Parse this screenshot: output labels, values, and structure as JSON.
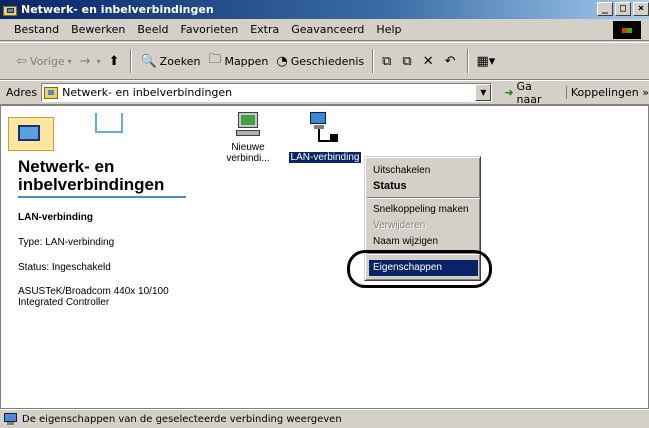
{
  "window": {
    "title": "Netwerk- en inbelverbindingen",
    "buttons": [
      "_",
      "□",
      "×"
    ]
  },
  "menubar": {
    "items": [
      "Bestand",
      "Bewerken",
      "Beeld",
      "Favorieten",
      "Extra",
      "Geavanceerd",
      "Help"
    ]
  },
  "toolbar": {
    "back": "Vorige",
    "forward": "→",
    "up": "⬆",
    "search": "Zoeken",
    "folders": "Mappen",
    "history": "Geschiedenis",
    "views": "▦▾"
  },
  "addressbar": {
    "label": "Adres",
    "value": "Netwerk- en inbelverbindingen",
    "go": "Ga naar",
    "links": "Koppelingen »"
  },
  "webview": {
    "title": "Netwerk- en inbelverbindingen",
    "selected_name": "LAN-verbinding",
    "type_line": "Type: LAN-verbinding",
    "status_line": "Status: Ingeschakeld",
    "device_line1": "ASUSTeK/Broadcom 440x 10/100",
    "device_line2": "Integrated Controller"
  },
  "icons": [
    {
      "label_line1": "Nieuwe",
      "label_line2": "verbindi..."
    },
    {
      "label": "LAN-verbinding"
    }
  ],
  "context_menu": {
    "items": [
      {
        "label": "Uitschakelen",
        "style": "normal"
      },
      {
        "label": "Status",
        "style": "bold"
      },
      {
        "label": "Snelkoppeling maken",
        "style": "normal"
      },
      {
        "label": "Verwijderen",
        "style": "disabled"
      },
      {
        "label": "Naam wijzigen",
        "style": "normal"
      },
      {
        "label": "Eigenschappen",
        "style": "selected"
      }
    ]
  },
  "statusbar": {
    "text": "De eigenschappen van de geselecteerde verbinding weergeven"
  },
  "colors": {
    "title_active": "#0a246a",
    "selection": "#0a246a",
    "face": "#d4d0c8"
  }
}
